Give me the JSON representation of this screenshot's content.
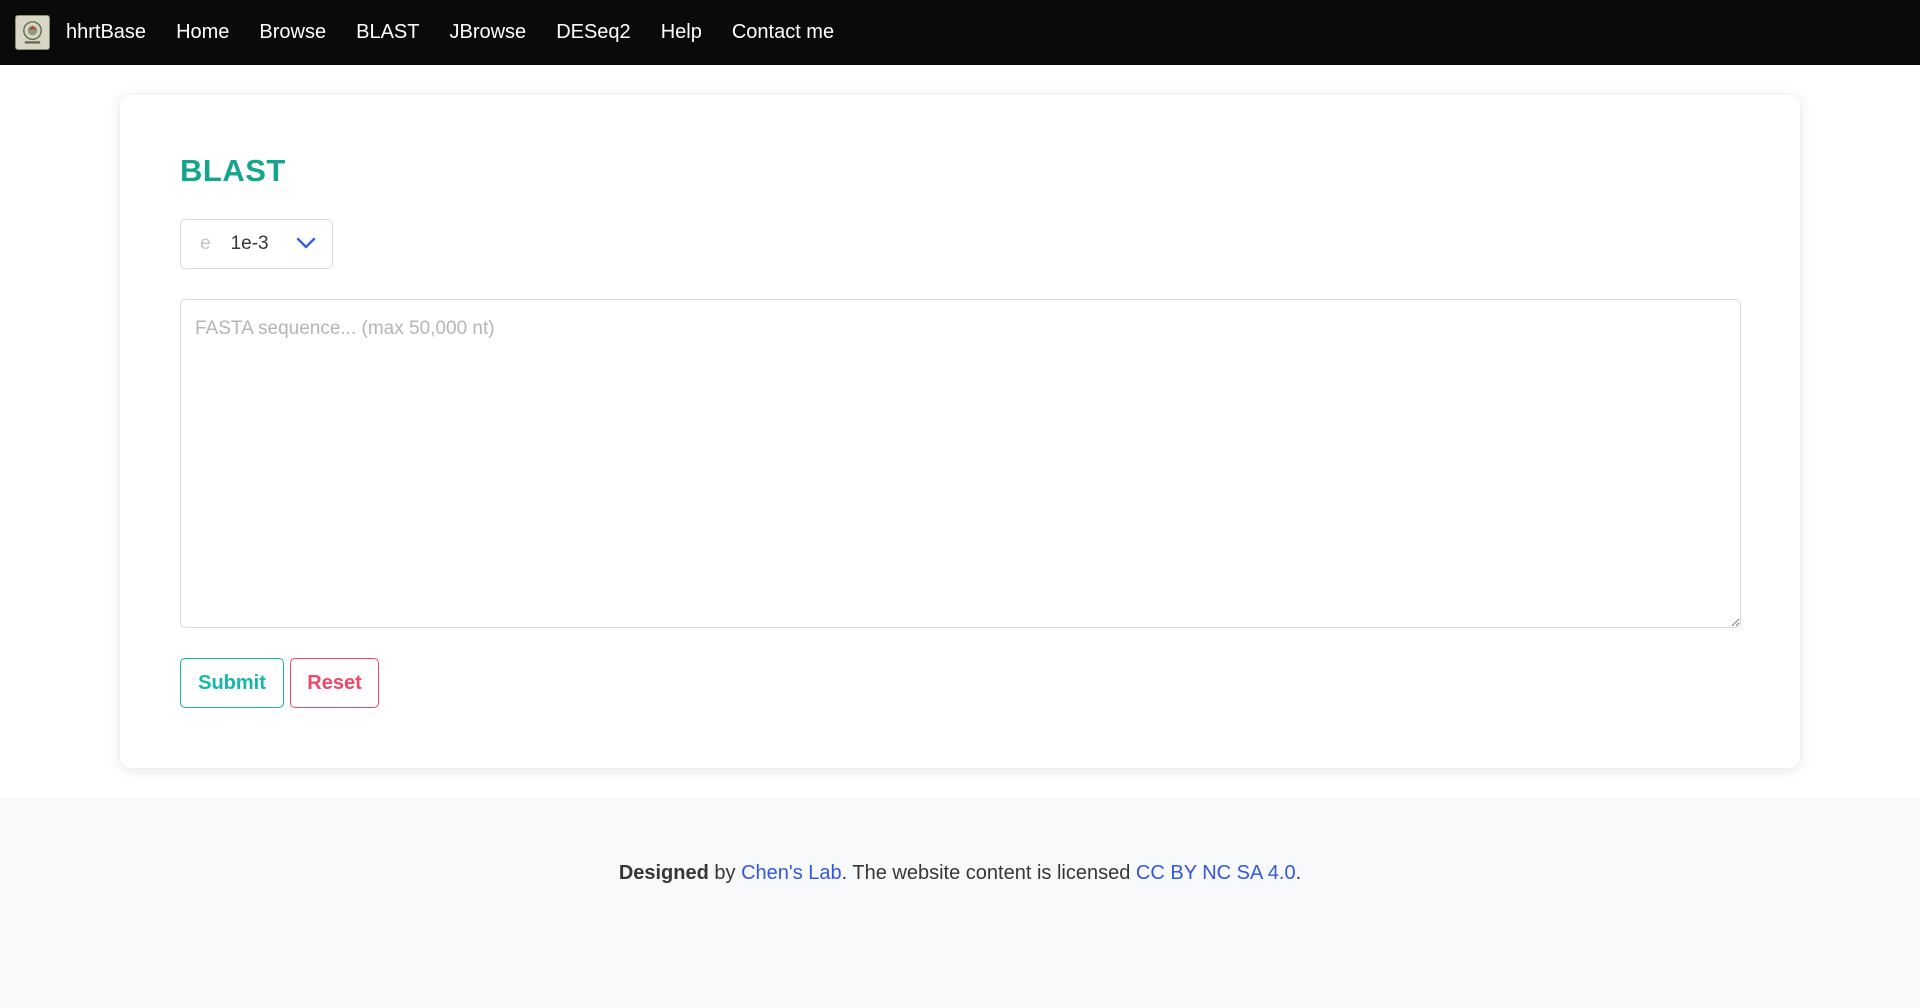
{
  "nav": {
    "brand": "hhrtBase",
    "logo_icon": "seal-logo-icon",
    "items": [
      "Home",
      "Browse",
      "BLAST",
      "JBrowse",
      "DESeq2",
      "Help",
      "Contact me"
    ]
  },
  "main": {
    "title": "BLAST",
    "evalue": {
      "prefix": "e",
      "selected": "1e-3"
    },
    "sequence": {
      "placeholder": "FASTA sequence... (max 50,000 nt)",
      "value": ""
    },
    "buttons": {
      "submit": "Submit",
      "reset": "Reset"
    }
  },
  "footer": {
    "designed": "Designed",
    "by": " by ",
    "lab": "Chen's Lab",
    "middle": ". The website content is licensed ",
    "license": "CC BY NC SA 4.0",
    "end": "."
  },
  "colors": {
    "navbar": "#0a0a0a",
    "title": "#14a58e",
    "submit": "#14b8a6",
    "reset": "#f14668",
    "link": "#3457dc"
  }
}
